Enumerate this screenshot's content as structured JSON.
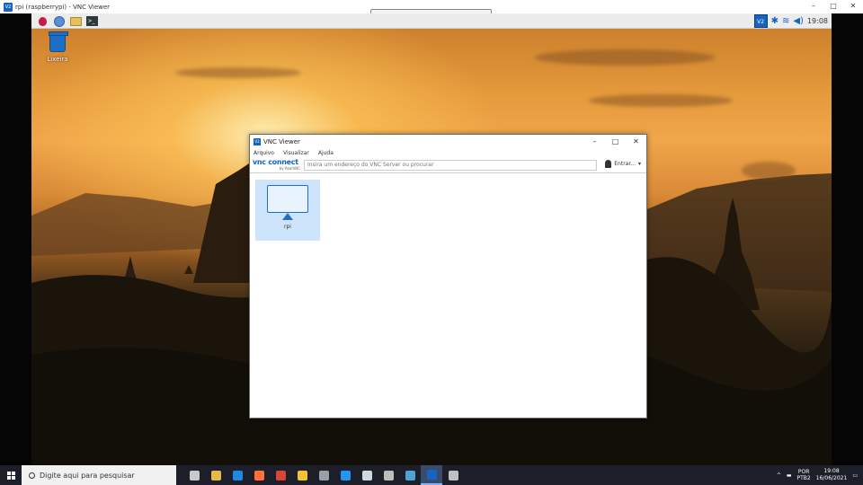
{
  "outer_window": {
    "title": "rpi (raspberrypi) - VNC Viewer",
    "icon_label": "V2",
    "controls": [
      "–",
      "□",
      "✕"
    ]
  },
  "pi_panel": {
    "launchers": [
      "raspberry-pi-menu",
      "web-browser",
      "file-manager",
      "terminal"
    ],
    "terminal_glyph": ">_",
    "tray_vnc_label": "V2",
    "bluetooth_glyph": "✱",
    "wifi_glyph": "≋",
    "volume_glyph": "◀)",
    "time": "19:08"
  },
  "desktop": {
    "trash_label": "Lixeira"
  },
  "vnc_viewer": {
    "title": "VNC Viewer",
    "icon_label": "V2",
    "controls": [
      "–",
      "□",
      "✕"
    ],
    "menu": [
      "Arquivo",
      "Visualizar",
      "Ajuda"
    ],
    "brand_main": "vnc connect",
    "brand_sub": "by RealVNC",
    "search_placeholder": "Insira um endereço do VNC Server ou procurar",
    "signin_label": "Entrar...",
    "signin_caret": "▾",
    "computers": [
      {
        "name": "rpi"
      }
    ]
  },
  "taskbar": {
    "search_placeholder": "Digite aqui para pesquisar",
    "apps": [
      {
        "name": "task-view",
        "color": "#c9c9c9"
      },
      {
        "name": "explorer",
        "color": "#e8b84a"
      },
      {
        "name": "edge",
        "color": "#1e88e5"
      },
      {
        "name": "firefox",
        "color": "#ff7139"
      },
      {
        "name": "chrome",
        "color": "#db4437"
      },
      {
        "name": "files",
        "color": "#f1c232"
      },
      {
        "name": "app",
        "color": "#9aa0a6"
      },
      {
        "name": "vscode",
        "color": "#2196f3"
      },
      {
        "name": "calculator",
        "color": "#cfd8dc"
      },
      {
        "name": "settings",
        "color": "#bdbdbd"
      },
      {
        "name": "app2",
        "color": "#4fa3d1"
      },
      {
        "name": "vnc-viewer",
        "color": "#1565c0"
      },
      {
        "name": "app3",
        "color": "#c0c0c0"
      }
    ],
    "active_app": "vnc-viewer",
    "tray_caret": "^",
    "lang_top": "POR",
    "lang_bottom": "PTB2",
    "clock_time": "19:08",
    "clock_date": "16/06/2021",
    "notification_glyph": "▭"
  },
  "colors": {
    "accent": "#1565c0",
    "tile_selected": "#cde4fa",
    "taskbar": "#1c1f2a"
  }
}
